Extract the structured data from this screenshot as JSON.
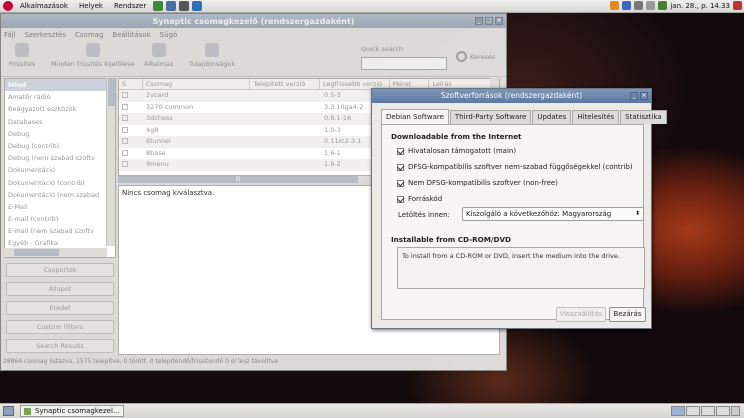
{
  "top_panel": {
    "menus": [
      "Alkalmazások",
      "Helyek",
      "Rendszer"
    ],
    "clock": "jan. 28., p. 14.33"
  },
  "synaptic": {
    "title": "Synaptic csomagkezelő (rendszergazdaként)",
    "menubar": [
      "Fájl",
      "Szerkesztés",
      "Csomag",
      "Beállítások",
      "Súgó"
    ],
    "toolbar": {
      "reload": "Frissítés",
      "mark_all": "Minden frissítés kijelölése",
      "apply": "Alkalmaz",
      "properties": "Tulajdonságok",
      "quick_search_label": "Quick search",
      "search": "Keresés"
    },
    "sections": [
      "Mind",
      "Amatőr rádió",
      "Beágyazott eszközök",
      "Databases",
      "Debug",
      "Debug (contrib)",
      "Debug (nem szabad szoftv",
      "Dokumentáció",
      "Dokumentáció (contrib)",
      "Dokumentáció (nem szabad",
      "E-Mail",
      "E-mail (contrib)",
      "E-mail (nem szabad szoftv",
      "Egyéb - Grafika"
    ],
    "filter_buttons": [
      "Csoportok",
      "Állapot",
      "Eredet",
      "Custom Filters",
      "Search Results"
    ],
    "columns": [
      "S",
      "Csomag",
      "Telepített verzió",
      "Legfrissebb verzió",
      "Méret",
      "Leírás"
    ],
    "packages": [
      {
        "name": "2vcard",
        "latest": "0.5-3"
      },
      {
        "name": "3270-common",
        "latest": "3.3.10ga4-2"
      },
      {
        "name": "3dchess",
        "latest": "0.8.1-16"
      },
      {
        "name": "4g8",
        "latest": "1.0-3"
      },
      {
        "name": "6tunnel",
        "latest": "0.11rc2-3.1"
      },
      {
        "name": "8base",
        "latest": "1.6-1"
      },
      {
        "name": "9menu",
        "latest": "1.8-2"
      }
    ],
    "description": "Nincs csomag kiválasztva.",
    "status": "28864 csomag listázva, 1575 telepítve, 0 törött. 0 telepítendő/frissítendő 0 el lesz távolítva"
  },
  "dialog": {
    "title": "Szoftverforrások (rendszergazdaként)",
    "tabs": [
      "Debian Software",
      "Third-Party Software",
      "Updates",
      "Hitelesítés",
      "Statisztika"
    ],
    "section_internet": "Downloadable from the Internet",
    "options": [
      {
        "label": "Hivatalosan támogatott (main)",
        "checked": true
      },
      {
        "label": "DFSG-kompatibilis szoftver nem-szabad függőségekkel (contrib)",
        "checked": true
      },
      {
        "label": "Nem DFSG-kompatibilis szoftver (non-free)",
        "checked": true
      },
      {
        "label": "Forráskód",
        "checked": true
      }
    ],
    "download_from_label": "Letöltés innen:",
    "download_from_value": "Kiszolgáló a következőhöz: Magyarország",
    "section_cdrom": "Installable from CD-ROM/DVD",
    "cdrom_text": "To install from a CD-ROM or DVD, insert the medium into the drive.",
    "revert": "Visszaállítás",
    "close": "Bezárás"
  },
  "taskbar": {
    "task": "Synaptic csomagkezel..."
  }
}
